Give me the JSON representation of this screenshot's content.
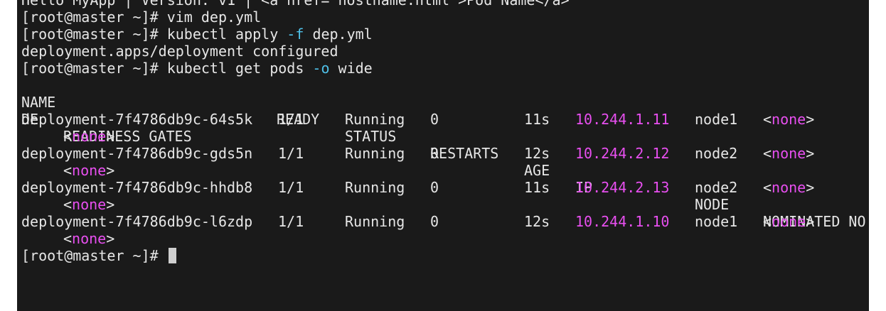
{
  "terminal": {
    "top_line": "Hello MyApp | Version: v1 | <a href=\"hostname.html\">Pod Name</a>",
    "cmd1": {
      "prompt": "[root@master ~]#",
      "command": "vim dep.yml"
    },
    "cmd2": {
      "prompt": "[root@master ~]#",
      "command_pre": "kubectl apply",
      "flag": "-f",
      "command_post": "dep.yml"
    },
    "cmd2_output": "deployment.apps/deployment configured",
    "cmd3": {
      "prompt": "[root@master ~]#",
      "command_pre": "kubectl get pods",
      "flag": "-o",
      "command_post": "wide"
    },
    "headers": {
      "name": "NAME",
      "ready": "READY",
      "status": "STATUS",
      "restarts": "RESTARTS",
      "age": "AGE",
      "ip": "IP",
      "node": "NODE",
      "nominated_wrap_a": "NOMINATED NO",
      "nominated_wrap_b": "DE",
      "readiness_gates": "READINESS GATES"
    },
    "pods": [
      {
        "name": "deployment-7f4786db9c-64s5k",
        "ready": "1/1",
        "status": "Running",
        "restarts": "0",
        "age": "11s",
        "ip": "10.244.1.11",
        "node": "node1",
        "nominated": "none",
        "gates": "none"
      },
      {
        "name": "deployment-7f4786db9c-gds5n",
        "ready": "1/1",
        "status": "Running",
        "restarts": "0",
        "age": "12s",
        "ip": "10.244.2.12",
        "node": "node2",
        "nominated": "none",
        "gates": "none"
      },
      {
        "name": "deployment-7f4786db9c-hhdb8",
        "ready": "1/1",
        "status": "Running",
        "restarts": "0",
        "age": "11s",
        "ip": "10.244.2.13",
        "node": "node2",
        "nominated": "none",
        "gates": "none"
      },
      {
        "name": "deployment-7f4786db9c-l6zdp",
        "ready": "1/1",
        "status": "Running",
        "restarts": "0",
        "age": "12s",
        "ip": "10.244.1.10",
        "node": "node1",
        "nominated": "none",
        "gates": "none"
      }
    ],
    "final_prompt": "[root@master ~]#"
  },
  "colors": {
    "background": "#1a1a1a",
    "text": "#e6e6e6",
    "flag": "#4fc1e9",
    "highlight": "#e84ff0"
  }
}
